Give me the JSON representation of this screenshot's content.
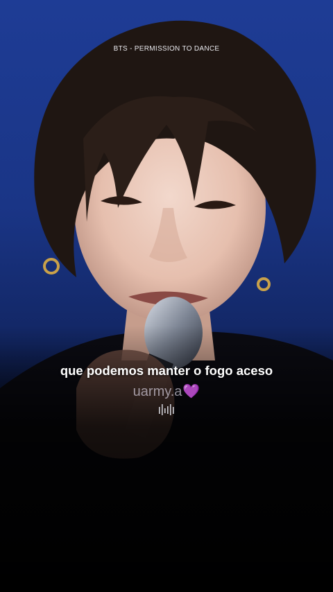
{
  "video": {
    "song_title": "BTS - PERMISSION TO DANCE",
    "lyric": "que podemos manter o fogo aceso",
    "watermark": "uarmy.a",
    "watermark_emoji": "💜"
  },
  "colors": {
    "background_blue": "#1e3c95",
    "watermark_heart": "#9b4fd6",
    "text": "#ffffff"
  },
  "icons": {
    "audio": "audio-waveform-icon"
  }
}
